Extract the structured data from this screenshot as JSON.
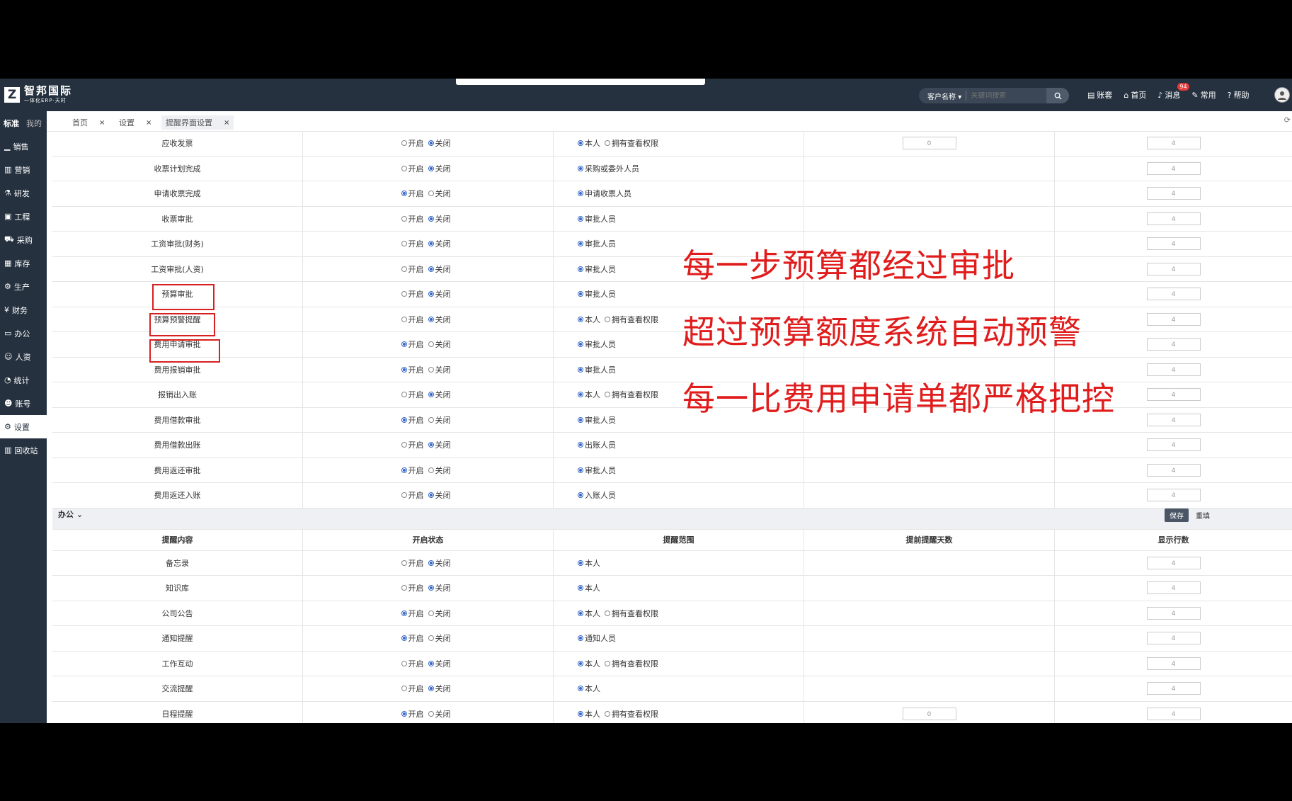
{
  "app": {
    "logo_name": "智邦国际",
    "logo_sub": "一体化ERP·天时"
  },
  "search": {
    "scope": "客户名称",
    "placeholder": "关键词搜索"
  },
  "topnav": [
    {
      "label": "账套",
      "icon": "ledger-icon"
    },
    {
      "label": "首页",
      "icon": "home-icon"
    },
    {
      "label": "消息",
      "icon": "bell-icon",
      "badge": "94"
    },
    {
      "label": "常用",
      "icon": "pin-icon"
    },
    {
      "label": "帮助",
      "icon": "help-icon"
    }
  ],
  "sidebar": {
    "tabs": [
      "标准",
      "我的"
    ],
    "items": [
      {
        "label": "销售",
        "icon": "chart-icon"
      },
      {
        "label": "营销",
        "icon": "bar-chart-icon"
      },
      {
        "label": "研发",
        "icon": "flask-icon"
      },
      {
        "label": "工程",
        "icon": "blueprint-icon"
      },
      {
        "label": "采购",
        "icon": "cart-icon"
      },
      {
        "label": "库存",
        "icon": "warehouse-icon"
      },
      {
        "label": "生产",
        "icon": "factory-icon"
      },
      {
        "label": "财务",
        "icon": "yen-icon"
      },
      {
        "label": "办公",
        "icon": "briefcase-icon"
      },
      {
        "label": "人资",
        "icon": "person-icon"
      },
      {
        "label": "统计",
        "icon": "pie-icon"
      },
      {
        "label": "账号",
        "icon": "user-icon"
      },
      {
        "label": "设置",
        "icon": "gear-icon",
        "active": true
      },
      {
        "label": "回收站",
        "icon": "trash-icon"
      }
    ]
  },
  "tabs": [
    {
      "label": "首页",
      "close": "×"
    },
    {
      "label": "设置",
      "close": "×"
    },
    {
      "label": "提醒界面设置",
      "close": "×",
      "active": true
    }
  ],
  "radio_labels": {
    "on": "开启",
    "off": "关闭"
  },
  "finance_rows": [
    {
      "content": "应收发票",
      "status": "off",
      "scope": [
        {
          "label": "本人",
          "checked": true
        },
        {
          "label": "拥有查看权限",
          "checked": false
        }
      ],
      "days": "0",
      "rows": "4"
    },
    {
      "content": "收票计划完成",
      "status": "off",
      "scope": [
        {
          "label": "采购或委外人员",
          "checked": true
        }
      ],
      "days": "",
      "rows": "4"
    },
    {
      "content": "申请收票完成",
      "status": "on",
      "scope": [
        {
          "label": "申请收票人员",
          "checked": true
        }
      ],
      "days": "",
      "rows": "4"
    },
    {
      "content": "收票审批",
      "status": "off",
      "scope": [
        {
          "label": "审批人员",
          "checked": true
        }
      ],
      "days": "",
      "rows": "4"
    },
    {
      "content": "工资审批(财务)",
      "status": "off",
      "scope": [
        {
          "label": "审批人员",
          "checked": true
        }
      ],
      "days": "",
      "rows": "4"
    },
    {
      "content": "工资审批(人资)",
      "status": "off",
      "scope": [
        {
          "label": "审批人员",
          "checked": true
        }
      ],
      "days": "",
      "rows": "4"
    },
    {
      "content": "预算审批",
      "status": "off",
      "scope": [
        {
          "label": "审批人员",
          "checked": true
        }
      ],
      "days": "",
      "rows": "4"
    },
    {
      "content": "预算预警提醒",
      "status": "off",
      "scope": [
        {
          "label": "本人",
          "checked": true
        },
        {
          "label": "拥有查看权限",
          "checked": false
        }
      ],
      "days": "",
      "rows": "4"
    },
    {
      "content": "费用申请审批",
      "status": "on",
      "scope": [
        {
          "label": "审批人员",
          "checked": true
        }
      ],
      "days": "",
      "rows": "4"
    },
    {
      "content": "费用报销审批",
      "status": "on",
      "scope": [
        {
          "label": "审批人员",
          "checked": true
        }
      ],
      "days": "",
      "rows": "4"
    },
    {
      "content": "报销出入账",
      "status": "off",
      "scope": [
        {
          "label": "本人",
          "checked": true
        },
        {
          "label": "拥有查看权限",
          "checked": false
        }
      ],
      "days": "",
      "rows": "4"
    },
    {
      "content": "费用借款审批",
      "status": "on",
      "scope": [
        {
          "label": "审批人员",
          "checked": true
        }
      ],
      "days": "",
      "rows": "4"
    },
    {
      "content": "费用借款出账",
      "status": "off",
      "scope": [
        {
          "label": "出账人员",
          "checked": true
        }
      ],
      "days": "",
      "rows": "4"
    },
    {
      "content": "费用返还审批",
      "status": "on",
      "scope": [
        {
          "label": "审批人员",
          "checked": true
        }
      ],
      "days": "",
      "rows": "4"
    },
    {
      "content": "费用返还入账",
      "status": "off",
      "scope": [
        {
          "label": "入账人员",
          "checked": true
        }
      ],
      "days": "",
      "rows": "4"
    }
  ],
  "office_section": {
    "title": "办公",
    "save": "保存",
    "reset": "重填"
  },
  "columns": [
    "提醒内容",
    "开启状态",
    "提醒范围",
    "提前提醒天数",
    "显示行数"
  ],
  "office_rows": [
    {
      "content": "备忘录",
      "status": "off",
      "scope": [
        {
          "label": "本人",
          "checked": true
        }
      ],
      "days": "",
      "rows": "4"
    },
    {
      "content": "知识库",
      "status": "off",
      "scope": [
        {
          "label": "本人",
          "checked": true
        }
      ],
      "days": "",
      "rows": "4"
    },
    {
      "content": "公司公告",
      "status": "on",
      "scope": [
        {
          "label": "本人",
          "checked": true
        },
        {
          "label": "拥有查看权限",
          "checked": false
        }
      ],
      "days": "",
      "rows": "4"
    },
    {
      "content": "通知提醒",
      "status": "on",
      "scope": [
        {
          "label": "通知人员",
          "checked": true
        }
      ],
      "days": "",
      "rows": "4"
    },
    {
      "content": "工作互动",
      "status": "off",
      "scope": [
        {
          "label": "本人",
          "checked": true
        },
        {
          "label": "拥有查看权限",
          "checked": false
        }
      ],
      "days": "",
      "rows": "4"
    },
    {
      "content": "交流提醒",
      "status": "off",
      "scope": [
        {
          "label": "本人",
          "checked": true
        }
      ],
      "days": "",
      "rows": "4"
    },
    {
      "content": "日程提醒",
      "status": "on",
      "scope": [
        {
          "label": "本人",
          "checked": true
        },
        {
          "label": "拥有查看权限",
          "checked": false
        }
      ],
      "days": "0",
      "rows": "4"
    }
  ],
  "annotations": [
    "每一步预算都经过审批",
    "超过预算额度系统自动预警",
    "每一比费用申请单都严格把控"
  ],
  "colors": {
    "topbar": "#25313f",
    "accent": "#3466c6",
    "annotation": "#e01c1c"
  }
}
